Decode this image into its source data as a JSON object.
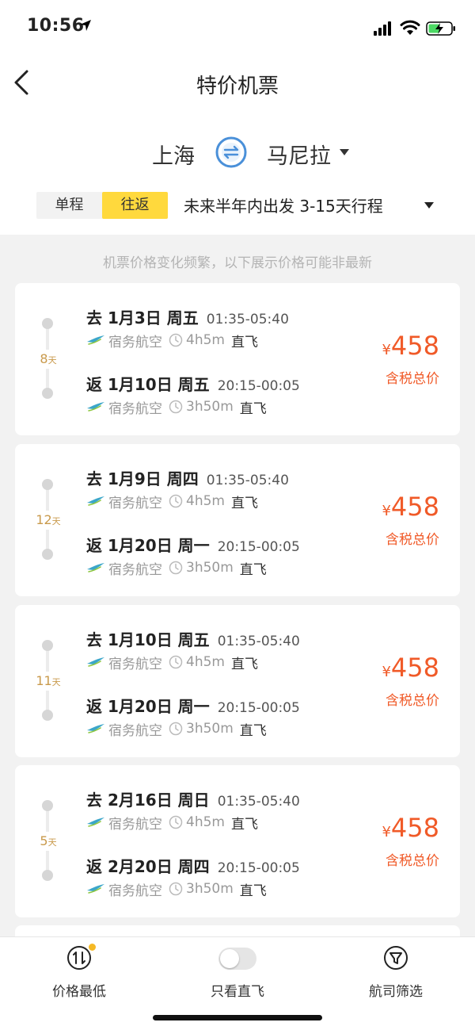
{
  "status_bar": {
    "time": "10:56"
  },
  "header": {
    "title": "特价机票"
  },
  "route": {
    "origin": "上海",
    "destination": "马尼拉"
  },
  "trip_type": {
    "one_way": "单程",
    "round_trip": "往返",
    "selected": "往返"
  },
  "trip_filter": {
    "description": "未来半年内出发 3-15天行程"
  },
  "notice": "机票价格变化频繁，以下展示价格可能非最新",
  "colors": {
    "accent_yellow": "#ffd93d",
    "price": "#f05a28",
    "days": "#c99a4c"
  },
  "flights": [
    {
      "days": "8",
      "days_unit": "天",
      "outbound": {
        "head": "去 1月3日 周五",
        "times": "01:35-05:40",
        "airline": "宿务航空",
        "duration": "4h5m",
        "direct": "直飞"
      },
      "return": {
        "head": "返 1月10日 周五",
        "times": "20:15-00:05",
        "airline": "宿务航空",
        "duration": "3h50m",
        "direct": "直飞"
      },
      "currency": "¥",
      "price": "458",
      "price_label": "含税总价"
    },
    {
      "days": "12",
      "days_unit": "天",
      "outbound": {
        "head": "去 1月9日 周四",
        "times": "01:35-05:40",
        "airline": "宿务航空",
        "duration": "4h5m",
        "direct": "直飞"
      },
      "return": {
        "head": "返 1月20日 周一",
        "times": "20:15-00:05",
        "airline": "宿务航空",
        "duration": "3h50m",
        "direct": "直飞"
      },
      "currency": "¥",
      "price": "458",
      "price_label": "含税总价"
    },
    {
      "days": "11",
      "days_unit": "天",
      "outbound": {
        "head": "去 1月10日 周五",
        "times": "01:35-05:40",
        "airline": "宿务航空",
        "duration": "4h5m",
        "direct": "直飞"
      },
      "return": {
        "head": "返 1月20日 周一",
        "times": "20:15-00:05",
        "airline": "宿务航空",
        "duration": "3h50m",
        "direct": "直飞"
      },
      "currency": "¥",
      "price": "458",
      "price_label": "含税总价"
    },
    {
      "days": "5",
      "days_unit": "天",
      "outbound": {
        "head": "去 2月16日 周日",
        "times": "01:35-05:40",
        "airline": "宿务航空",
        "duration": "4h5m",
        "direct": "直飞"
      },
      "return": {
        "head": "返 2月20日 周四",
        "times": "20:15-00:05",
        "airline": "宿务航空",
        "duration": "3h50m",
        "direct": "直飞"
      },
      "currency": "¥",
      "price": "458",
      "price_label": "含税总价"
    }
  ],
  "bottom_bar": {
    "sort_label": "价格最低",
    "direct_label": "只看直飞",
    "direct_only": false,
    "airline_label": "航司筛选"
  }
}
